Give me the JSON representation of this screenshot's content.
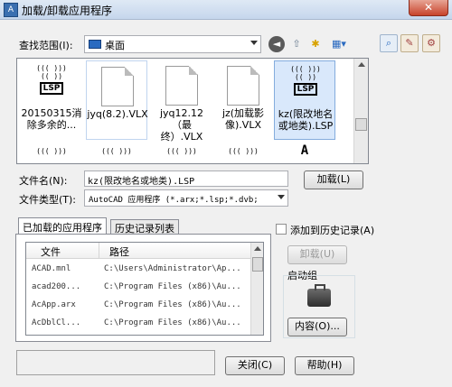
{
  "window": {
    "title": "加载/卸载应用程序",
    "close_label": "✕"
  },
  "search": {
    "label": "查找范围(I):",
    "location": "桌面"
  },
  "files": [
    {
      "name": "20150315消除多余的...",
      "type": "lsp"
    },
    {
      "name": "jyq(8.2).VLX",
      "type": "doc"
    },
    {
      "name": "jyq12.12（最终）.VLX",
      "type": "doc"
    },
    {
      "name": "jz(加载影像).VLX",
      "type": "doc"
    },
    {
      "name": "kz(限改地名或地类).LSP",
      "type": "lsp"
    }
  ],
  "filename": {
    "label": "文件名(N):",
    "value": "kz(限改地名或地类).LSP",
    "load_button": "加载(L)"
  },
  "filetype": {
    "label": "文件类型(T):",
    "value": "AutoCAD 应用程序 (*.arx;*.lsp;*.dvb;"
  },
  "tabs": {
    "loaded": "已加载的应用程序",
    "history": "历史记录列表"
  },
  "grid": {
    "col_file": "文件",
    "col_path": "路径",
    "rows": [
      {
        "file": "ACAD.mnl",
        "path": "C:\\Users\\Administrator\\Ap..."
      },
      {
        "file": "acad200...",
        "path": "C:\\Program Files (x86)\\Au..."
      },
      {
        "file": "AcApp.arx",
        "path": "C:\\Program Files (x86)\\Au..."
      },
      {
        "file": "AcDblCl...",
        "path": "C:\\Program Files (x86)\\Au..."
      }
    ]
  },
  "side": {
    "add_history": "添加到历史记录(A)",
    "unload": "卸载(U)",
    "startup_group": "启动组",
    "contents": "内容(O)..."
  },
  "footer": {
    "close": "关闭(C)",
    "help": "帮助(H)"
  }
}
